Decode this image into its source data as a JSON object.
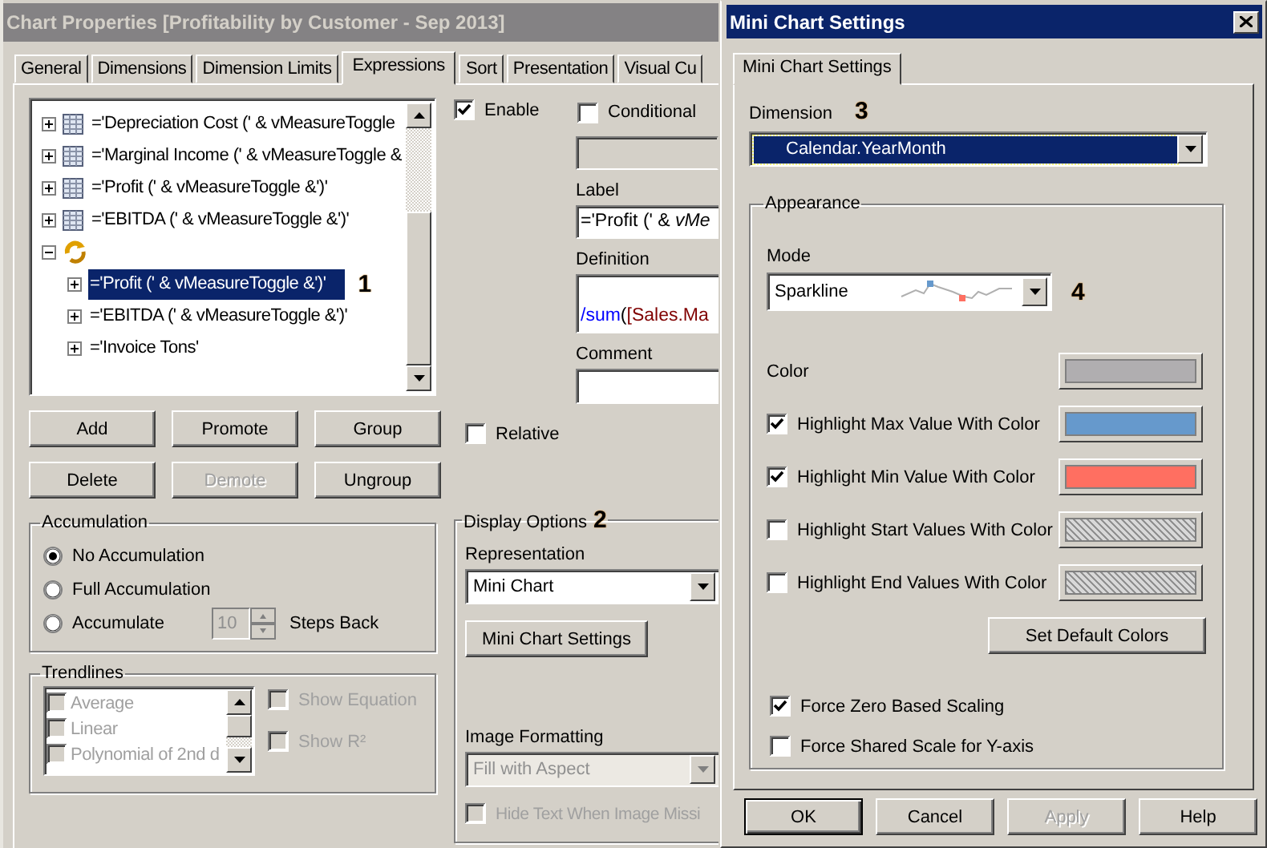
{
  "main_window": {
    "title": "Chart Properties [Profitability by Customer - Sep 2013]",
    "tabs": [
      {
        "label": "General",
        "selected": false
      },
      {
        "label": "Dimensions",
        "selected": false
      },
      {
        "label": "Dimension Limits",
        "selected": false
      },
      {
        "label": "Expressions",
        "selected": true
      },
      {
        "label": "Sort",
        "selected": false
      },
      {
        "label": "Presentation",
        "selected": false
      },
      {
        "label": "Visual Cu",
        "selected": false
      }
    ],
    "expressions_tree": {
      "marker": "1",
      "items": [
        {
          "label": "='Depreciation Cost (' & vMeasureToggle",
          "expanded": false,
          "selected": false
        },
        {
          "label": "='Marginal Income (' & vMeasureToggle &",
          "expanded": false,
          "selected": false
        },
        {
          "label": "='Profit (' & vMeasureToggle &')'",
          "expanded": false,
          "selected": false
        },
        {
          "label": "='EBITDA (' & vMeasureToggle &')'",
          "expanded": false,
          "selected": false
        },
        {
          "expanded": true,
          "selected": false,
          "children": [
            {
              "label": "='Profit (' & vMeasureToggle &')'",
              "expanded": false,
              "selected": true
            },
            {
              "label": "='EBITDA (' & vMeasureToggle &')'",
              "expanded": false,
              "selected": false
            },
            {
              "label": "='Invoice Tons'",
              "expanded": false,
              "selected": false
            }
          ]
        }
      ]
    },
    "expression_buttons": [
      {
        "label": "Add",
        "disabled": false
      },
      {
        "label": "Promote",
        "disabled": false
      },
      {
        "label": "Group",
        "disabled": false
      },
      {
        "label": "Delete",
        "disabled": false
      },
      {
        "label": "Demote",
        "disabled": true
      },
      {
        "label": "Ungroup",
        "disabled": false
      }
    ],
    "accumulation": {
      "title": "Accumulation",
      "options": [
        {
          "label": "No Accumulation",
          "selected": true
        },
        {
          "label": "Full Accumulation",
          "selected": false
        },
        {
          "label": "Accumulate",
          "selected": false
        }
      ],
      "steps": {
        "value": "10",
        "disabled": true
      },
      "steps_label": "Steps Back"
    },
    "trendlines": {
      "title": "Trendlines",
      "disabled": true,
      "items": [
        {
          "label": "Average",
          "checked": false
        },
        {
          "label": "Linear",
          "checked": false
        },
        {
          "label": "Polynomial of 2nd d",
          "checked": false
        }
      ],
      "options": [
        {
          "label": "Show Equation",
          "checked": false
        },
        {
          "label": "Show R²",
          "checked": false
        }
      ]
    },
    "enable": {
      "label": "Enable",
      "checked": true
    },
    "conditional": {
      "label": "Conditional",
      "checked": false
    },
    "label_field": {
      "label": "Label",
      "value": "='Profit (' & *vMe*"
    },
    "definition": {
      "label": "Definition",
      "tokens": [
        {
          "kind": "function",
          "text": "/sum"
        },
        {
          "kind": "plain",
          "text": "("
        },
        {
          "kind": "field",
          "text": "[Sales.Ma"
        }
      ]
    },
    "comment": {
      "label": "Comment"
    },
    "relative": {
      "label": "Relative",
      "checked": false
    },
    "display_options": {
      "title": "Display Options",
      "marker": "2",
      "representation_label": "Representation",
      "representation": "Mini Chart",
      "settings_button": "Mini Chart Settings",
      "image_formatting_label": "Image Formatting",
      "image_formatting": {
        "value": "Fill with Aspect",
        "disabled": true
      },
      "hide_text": {
        "label": "Hide Text When Image Missi",
        "checked": false,
        "disabled": true
      }
    }
  },
  "mini_chart_dialog": {
    "title": "Mini Chart Settings",
    "tabs": [
      {
        "label": "Mini Chart Settings",
        "selected": true
      }
    ],
    "dimension": {
      "label": "Dimension",
      "marker": "3",
      "value": "Calendar.YearMonth",
      "selected": true
    },
    "appearance": {
      "title": "Appearance",
      "mode_label": "Mode",
      "mode": "Sparkline",
      "marker": "4",
      "color_rows": [
        {
          "kind": "plain",
          "label": "Color",
          "color": "#b0aeb0"
        },
        {
          "kind": "checkbox",
          "label": "Highlight Max Value With Color",
          "checked": true,
          "color": "#6699cc"
        },
        {
          "kind": "checkbox",
          "label": "Highlight Min Value With Color",
          "checked": true,
          "color": "#ff6f61"
        },
        {
          "kind": "checkbox",
          "label": "Highlight Start Values With Color",
          "checked": false
        },
        {
          "kind": "checkbox",
          "label": "Highlight End Values With Color",
          "checked": false
        }
      ],
      "default_colors_button": "Set Default Colors",
      "scaling": [
        {
          "label": "Force Zero Based Scaling",
          "checked": true
        },
        {
          "label": "Force Shared Scale for Y-axis",
          "checked": false
        }
      ]
    },
    "buttons": [
      {
        "label": "OK",
        "disabled": false,
        "default": true
      },
      {
        "label": "Cancel",
        "disabled": false,
        "default": false
      },
      {
        "label": "Apply",
        "disabled": true,
        "default": false
      },
      {
        "label": "Help",
        "disabled": false,
        "default": false
      }
    ]
  }
}
